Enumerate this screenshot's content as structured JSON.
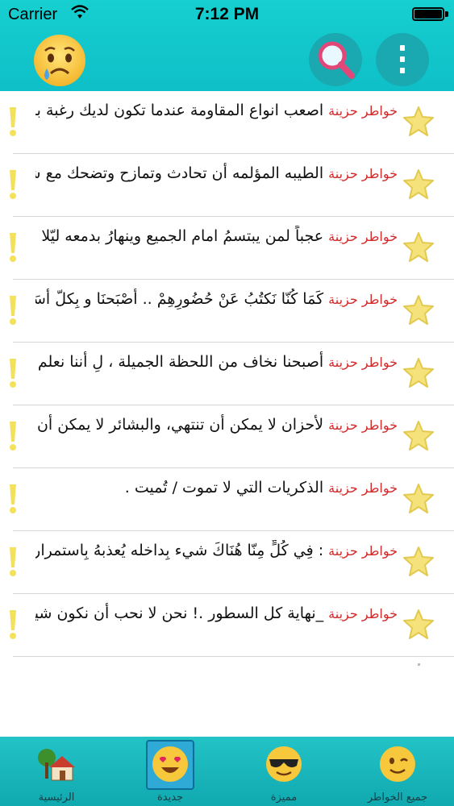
{
  "statusbar": {
    "carrier": "Carrier",
    "time": "7:12 PM"
  },
  "header": {
    "left_icon": "crying-face-icon",
    "search_icon": "magnifier-icon",
    "menu_icon": "vertical-dots-icon"
  },
  "list": {
    "items": [
      {
        "category": "خواطر حزينة",
        "text": "اصعب انواع المقاومة عندما تكون لديك رغبة بالبكاء ولكنك تبتسم لتحمي كبرياء..."
      },
      {
        "category": "خواطر حزينة",
        "text": "الطيبه المؤلمه أن تحادث وتمازح وتضحك مع شخص جرحك سابقا وكأنه لم يف..."
      },
      {
        "category": "خواطر حزينة",
        "text": "عجباً لمن يبتسمُ امام الجميع وينهارُ بدمعه ليّلا"
      },
      {
        "category": "خواطر حزينة",
        "text": "كَمَا كُنّا نَكتُبُ عَنْ حُضُورِهِمْ .. أَصْبَحنَا و بِكلّ أَسَفْ نَكتُبُ عَنْ غِيابهِمْ ،،"
      },
      {
        "category": "خواطر حزينة",
        "text": "أصبحنا نخاف من اللحظة الجميلة ، لِ أننا نعلم انها ستصبح ذكرى مؤله جداً ي..."
      },
      {
        "category": "خواطر حزينة",
        "text": "لأحزان لا يمكن أن تنتهي، والبشائر لا يمكن أن تختفي، كل ما عليك أن تدرب نفس..."
      },
      {
        "category": "خواطر حزينة",
        "text": "الذكريات التي لا تموت / تُميت ."
      },
      {
        "category": "خواطر حزينة",
        "text": ": فِي كُلٍّ مِنّا هُنَاكَ شيء بِداخله يُعذبهُ بِاستمرار"
      },
      {
        "category": "خواطر حزينة",
        "text": "_نهاية كل السطور .! نحن لا نحب أن نكون شيئا مؤقتا"
      }
    ],
    "warn_icon": "exclamation-icon",
    "star_icon": "star-icon"
  },
  "tabbar": {
    "tabs": [
      {
        "label": "الرئيسية",
        "icon": "house-icon"
      },
      {
        "label": "جديدة",
        "icon": "heart-eyes-face-icon",
        "selected": true
      },
      {
        "label": "مميزة",
        "icon": "sunglasses-face-icon"
      },
      {
        "label": "جميع الخواطر",
        "icon": "winking-face-icon"
      }
    ]
  },
  "colors": {
    "header": "#14c6cc",
    "category": "#d12a2a",
    "star": "#f5e27a",
    "warn": "#f3e15b"
  }
}
